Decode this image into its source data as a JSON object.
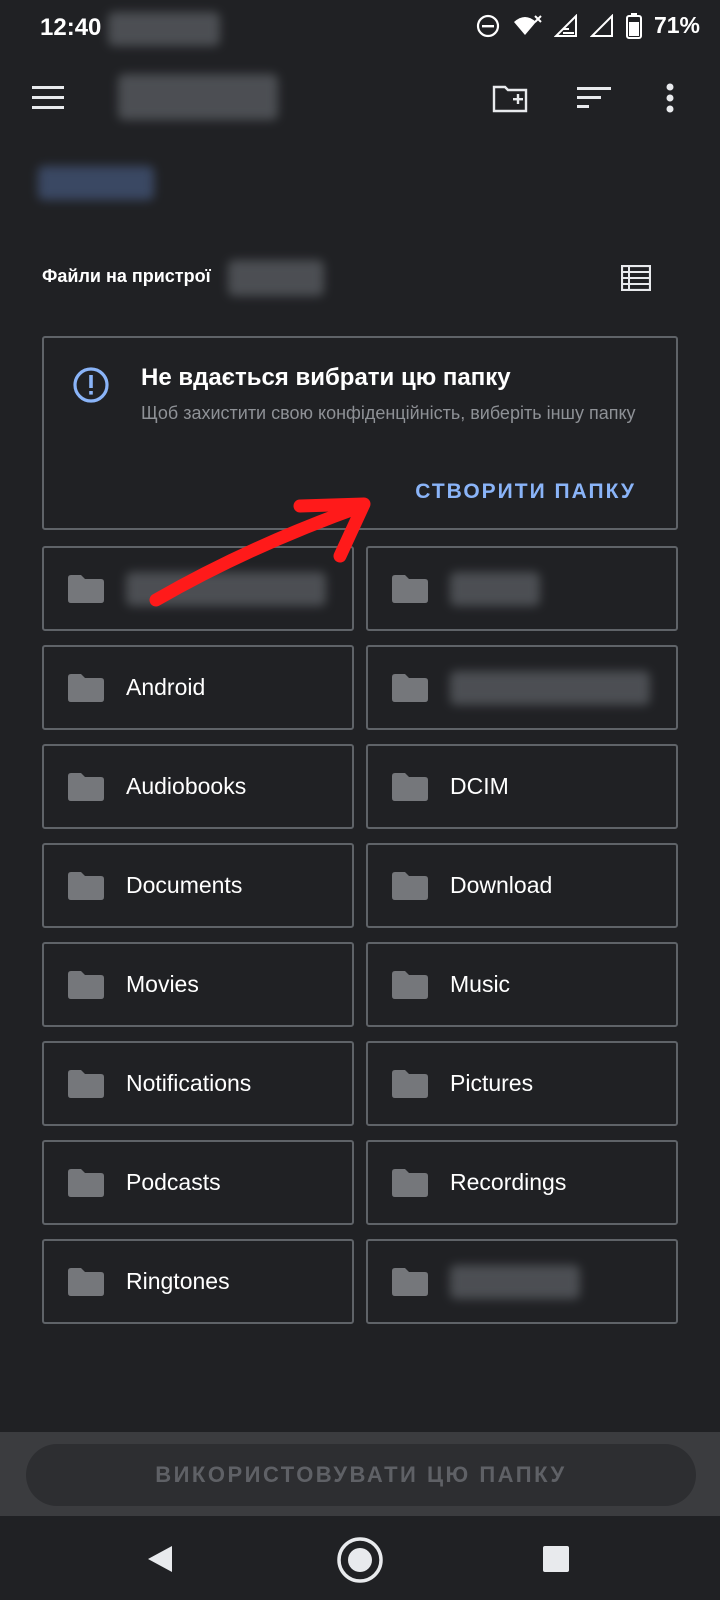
{
  "status_bar": {
    "time": "12:40",
    "battery_percent": "71%",
    "icons": [
      "do-not-disturb-icon",
      "wifi-icon",
      "signal-icon",
      "signal-icon",
      "battery-icon"
    ]
  },
  "toolbar": {
    "icons": [
      "menu-icon",
      "new-folder-icon",
      "sort-icon",
      "more-vert-icon"
    ]
  },
  "location": {
    "section_label": "Файли на пристрої"
  },
  "warning": {
    "title": "Не вдається вибрати цю папку",
    "subtitle": "Щоб захистити свою конфіденційність, виберіть іншу папку",
    "action": "СТВОРИТИ ПАПКУ",
    "accent_color": "#8ab4f8"
  },
  "folders": [
    {
      "name": ""
    },
    {
      "name": ""
    },
    {
      "name": "Android"
    },
    {
      "name": ""
    },
    {
      "name": "Audiobooks"
    },
    {
      "name": "DCIM"
    },
    {
      "name": "Documents"
    },
    {
      "name": "Download"
    },
    {
      "name": "Movies"
    },
    {
      "name": "Music"
    },
    {
      "name": "Notifications"
    },
    {
      "name": "Pictures"
    },
    {
      "name": "Podcasts"
    },
    {
      "name": "Recordings"
    },
    {
      "name": "Ringtones"
    },
    {
      "name": ""
    }
  ],
  "bottom": {
    "use_folder_label": "ВИКОРИСТОВУВАТИ ЦЮ ПАПКУ"
  },
  "nav": {
    "icons": [
      "back-icon",
      "home-icon",
      "recents-icon"
    ]
  },
  "annotation_color": "#ff1a1a"
}
